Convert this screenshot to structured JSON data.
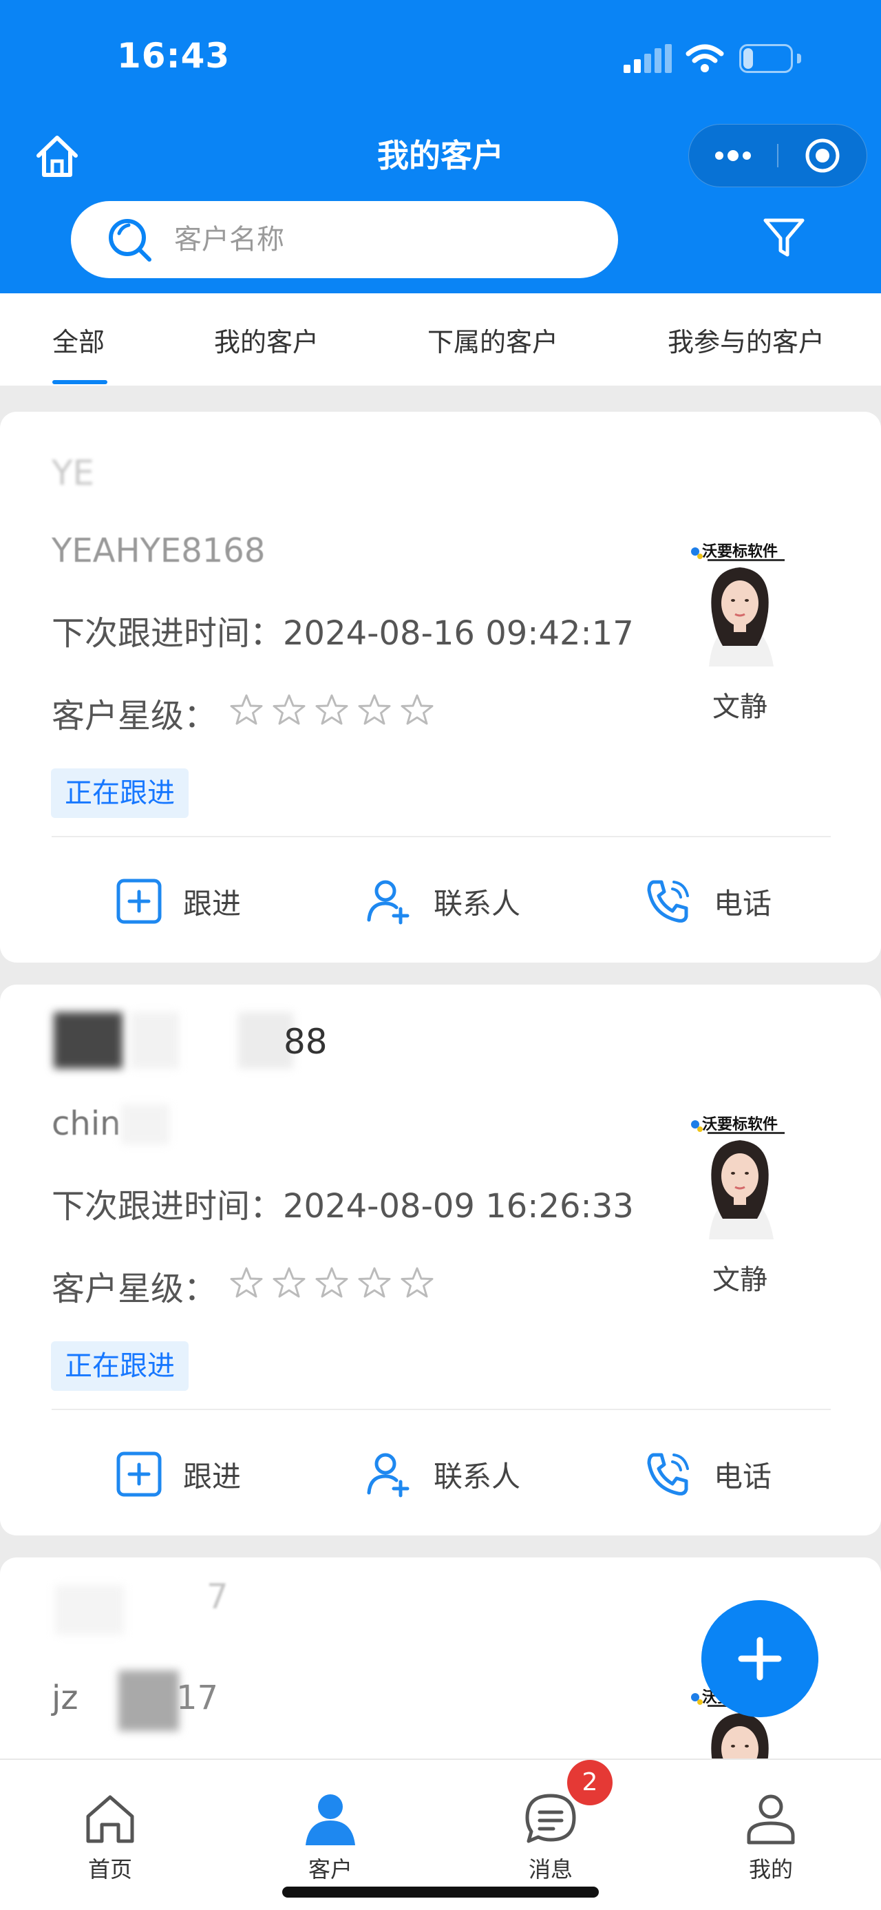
{
  "status_bar": {
    "time": "16:43",
    "battery": "21",
    "battery_level": 0.21
  },
  "header": {
    "title": "我的客户",
    "search_placeholder": "客户名称"
  },
  "tabs": [
    {
      "label": "全部",
      "active": true
    },
    {
      "label": "我的客户",
      "active": false
    },
    {
      "label": "下属的客户",
      "active": false
    },
    {
      "label": "我参与的客户",
      "active": false
    }
  ],
  "customers": [
    {
      "name": "YE",
      "code": "YEAHYE8168",
      "next_followup_label": "下次跟进时间：",
      "next_followup": "2024-08-16 09:42:17",
      "rating_label": "客户星级：",
      "stars": 0,
      "status": "正在跟进",
      "owner": "文静",
      "watermark": "沃要标软件"
    },
    {
      "name": "88",
      "code": "chin",
      "next_followup_label": "下次跟进时间：",
      "next_followup": "2024-08-09 16:26:33",
      "rating_label": "客户星级：",
      "stars": 0,
      "status": "正在跟进",
      "owner": "文静",
      "watermark": "沃要标软件"
    },
    {
      "name": "7",
      "code": "jz",
      "code_suffix": "17",
      "watermark": "沃要标软件"
    }
  ],
  "card_actions": {
    "follow": "跟进",
    "contact": "联系人",
    "phone": "电话"
  },
  "bottom_nav": [
    {
      "label": "首页",
      "icon": "home-icon",
      "active": false
    },
    {
      "label": "客户",
      "icon": "person-icon",
      "active": true
    },
    {
      "label": "消息",
      "icon": "message-icon",
      "active": false,
      "badge": "2"
    },
    {
      "label": "我的",
      "icon": "user-icon",
      "active": false
    }
  ],
  "colors": {
    "primary": "#0a84f5",
    "badge_bg": "#e6f2fd",
    "badge_red": "#e53935",
    "star": "#bbbbbb"
  }
}
